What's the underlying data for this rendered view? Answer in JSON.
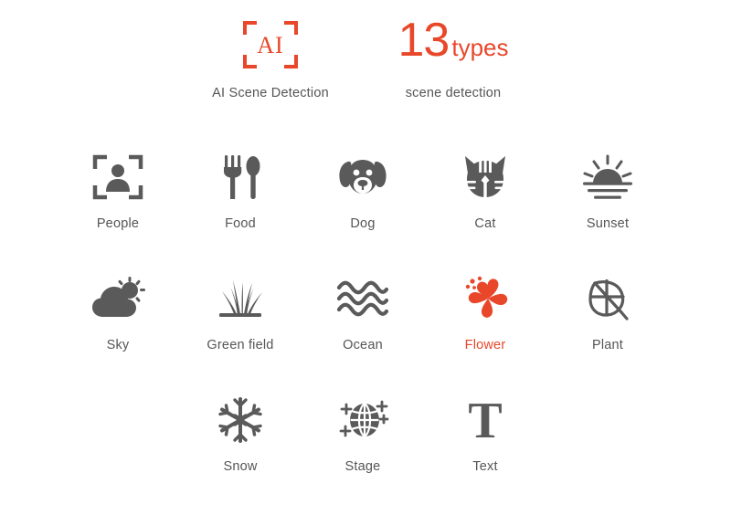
{
  "theme": {
    "background": "#ffffff",
    "accent": "#E8472A",
    "icon_color": "#5A5A5A",
    "label_color": "#555555"
  },
  "header": {
    "ai": {
      "icon": "ai-viewfinder-icon",
      "icon_text": "AI",
      "caption": "AI Scene Detection"
    },
    "types": {
      "number": "13",
      "unit": "types",
      "caption": "scene detection"
    }
  },
  "scene_grid": {
    "rows": [
      [
        {
          "label": "People",
          "icon": "person-frame-icon",
          "active": false
        },
        {
          "label": "Food",
          "icon": "fork-spoon-icon",
          "active": false
        },
        {
          "label": "Dog",
          "icon": "dog-face-icon",
          "active": false
        },
        {
          "label": "Cat",
          "icon": "cat-face-icon",
          "active": false
        },
        {
          "label": "Sunset",
          "icon": "sunset-icon",
          "active": false
        }
      ],
      [
        {
          "label": "Sky",
          "icon": "cloud-sun-icon",
          "active": false
        },
        {
          "label": "Green field",
          "icon": "grass-icon",
          "active": false
        },
        {
          "label": "Ocean",
          "icon": "waves-icon",
          "active": false
        },
        {
          "label": "Flower",
          "icon": "flower-icon",
          "active": true
        },
        {
          "label": "Plant",
          "icon": "leaf-icon",
          "active": false
        }
      ],
      [
        {
          "label": "Snow",
          "icon": "snowflake-icon",
          "active": false
        },
        {
          "label": "Stage",
          "icon": "disco-ball-icon",
          "active": false
        },
        {
          "label": "Text",
          "icon": "text-t-icon",
          "active": false
        }
      ]
    ]
  }
}
